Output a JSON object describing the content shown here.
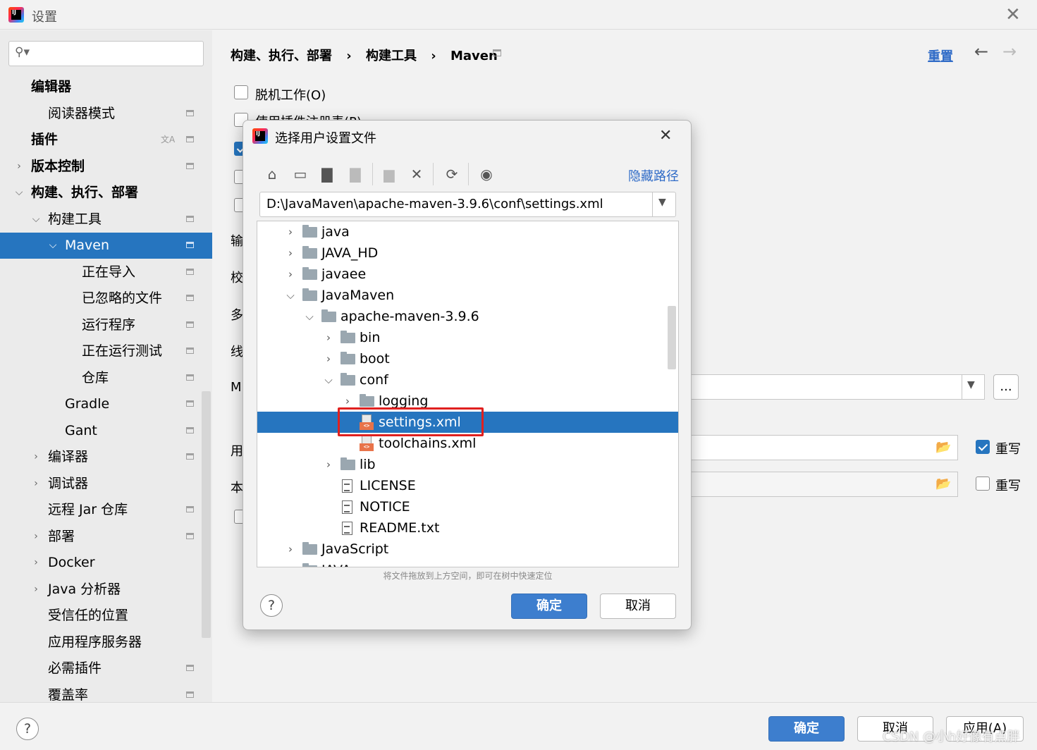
{
  "window": {
    "title": "设置"
  },
  "search": {
    "placeholder": ""
  },
  "sidebar": {
    "items": [
      {
        "label": "编辑器"
      },
      {
        "label": "阅读器模式"
      },
      {
        "label": "插件"
      },
      {
        "label": "版本控制"
      },
      {
        "label": "构建、执行、部署"
      },
      {
        "label": "构建工具"
      },
      {
        "label": "Maven"
      },
      {
        "label": "正在导入"
      },
      {
        "label": "已忽略的文件"
      },
      {
        "label": "运行程序"
      },
      {
        "label": "正在运行测试"
      },
      {
        "label": "仓库"
      },
      {
        "label": "Gradle"
      },
      {
        "label": "Gant"
      },
      {
        "label": "编译器"
      },
      {
        "label": "调试器"
      },
      {
        "label": "远程 Jar 仓库"
      },
      {
        "label": "部署"
      },
      {
        "label": "Docker"
      },
      {
        "label": "Java 分析器"
      },
      {
        "label": "受信任的位置"
      },
      {
        "label": "应用程序服务器"
      },
      {
        "label": "必需插件"
      },
      {
        "label": "覆盖率"
      }
    ]
  },
  "header": {
    "breadcrumb": [
      "构建、执行、部署",
      "构建工具",
      "Maven"
    ],
    "separator": "›",
    "reset_label": "重置"
  },
  "maven": {
    "offline_label": "脱机工作(O)",
    "plugin_registry_label": "使用插件注册表(P)",
    "row_labels": [
      "输",
      "校",
      "多",
      "线",
      "M",
      "用",
      "本"
    ],
    "browse_label": "...",
    "override_label": "重写",
    "override_checked": [
      true,
      false
    ]
  },
  "dialog": {
    "title": "选择用户设置文件",
    "hide_path_label": "隐藏路径",
    "path_value": "D:\\JavaMaven\\apache-maven-3.9.6\\conf\\settings.xml",
    "hint": "将文件拖放到上方空间，即可在树中快速定位",
    "ok_label": "确定",
    "cancel_label": "取消",
    "tree": [
      {
        "label": "java",
        "type": "folder",
        "expanded": false
      },
      {
        "label": "JAVA_HD",
        "type": "folder",
        "expanded": false
      },
      {
        "label": "javaee",
        "type": "folder",
        "expanded": false
      },
      {
        "label": "JavaMaven",
        "type": "folder",
        "expanded": true
      },
      {
        "label": "apache-maven-3.9.6",
        "type": "folder",
        "expanded": true
      },
      {
        "label": "bin",
        "type": "folder",
        "expanded": false
      },
      {
        "label": "boot",
        "type": "folder",
        "expanded": false
      },
      {
        "label": "conf",
        "type": "folder",
        "expanded": true
      },
      {
        "label": "logging",
        "type": "folder",
        "expanded": false
      },
      {
        "label": "settings.xml",
        "type": "xml",
        "selected": true
      },
      {
        "label": "toolchains.xml",
        "type": "xml"
      },
      {
        "label": "lib",
        "type": "folder",
        "expanded": false
      },
      {
        "label": "LICENSE",
        "type": "text"
      },
      {
        "label": "NOTICE",
        "type": "text"
      },
      {
        "label": "README.txt",
        "type": "text"
      },
      {
        "label": "JavaScript",
        "type": "folder",
        "expanded": false
      },
      {
        "label": "JAVA",
        "type": "folder",
        "expanded": false
      }
    ]
  },
  "footer": {
    "ok_label": "确定",
    "cancel_label": "取消",
    "apply_label": "应用(A)"
  },
  "watermark": "CSDN @小h好像有点胖",
  "colors": {
    "accent": "#2675bf",
    "link": "#2f6bc7",
    "highlight_box": "#e0201f",
    "primary_button": "#3d7ece"
  }
}
